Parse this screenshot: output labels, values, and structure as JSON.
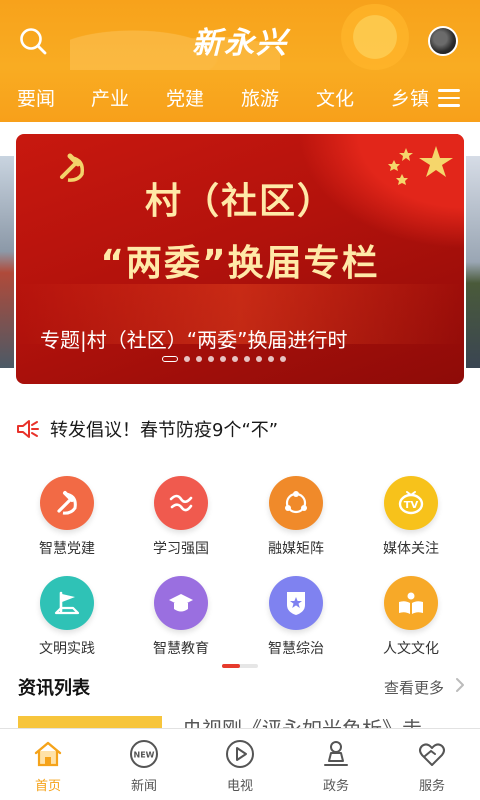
{
  "header": {
    "logo_text": "新永兴",
    "search_icon": "search-icon",
    "avatar_icon": "avatar",
    "channels": [
      "要闻",
      "产业",
      "党建",
      "旅游",
      "文化",
      "乡镇"
    ],
    "menu_icon": "menu-icon",
    "colors": {
      "header_bg": "#f8a61f",
      "text": "#ffffff"
    }
  },
  "banner": {
    "line1": "村（社区）",
    "line2": "“两委”换届专栏",
    "caption": "专题|村（社区）“两委”换届进行时",
    "slide_count": 10,
    "active_slide": 1,
    "colors": {
      "bg": "#b3120c",
      "headline": "#ffe9a8"
    }
  },
  "notice": {
    "icon": "megaphone-icon",
    "text": "转发倡议！春节防疫9个“不”"
  },
  "grid": {
    "items": [
      {
        "label": "智慧党建",
        "icon": "party-emblem-icon",
        "color": "#f26a45"
      },
      {
        "label": "学习强国",
        "icon": "xuexi-icon",
        "color": "#f05a4e"
      },
      {
        "label": "融媒矩阵",
        "icon": "share-network-icon",
        "color": "#f08a2a"
      },
      {
        "label": "媒体关注",
        "icon": "tv-icon",
        "color": "#f7c21b"
      },
      {
        "label": "文明实践",
        "icon": "flag-icon",
        "color": "#2fc2b6"
      },
      {
        "label": "智慧教育",
        "icon": "graduation-cap-icon",
        "color": "#9a6fe0"
      },
      {
        "label": "智慧综治",
        "icon": "police-badge-icon",
        "color": "#7f82f0"
      },
      {
        "label": "人文文化",
        "icon": "book-icon",
        "color": "#f7a928"
      }
    ],
    "page": 1,
    "pages": 2
  },
  "news": {
    "section_title": "资讯列表",
    "more_label": "查看更多",
    "first_item_title": "央视刚《评永如光鱼析》走"
  },
  "bottom_nav": {
    "items": [
      {
        "label": "首页",
        "icon": "home-icon",
        "active": true
      },
      {
        "label": "新闻",
        "icon": "news-icon",
        "active": false
      },
      {
        "label": "电视",
        "icon": "play-icon",
        "active": false
      },
      {
        "label": "政务",
        "icon": "government-icon",
        "active": false
      },
      {
        "label": "服务",
        "icon": "heart-hands-icon",
        "active": false
      }
    ],
    "colors": {
      "active": "#f5a31a",
      "inactive": "#555555"
    }
  }
}
